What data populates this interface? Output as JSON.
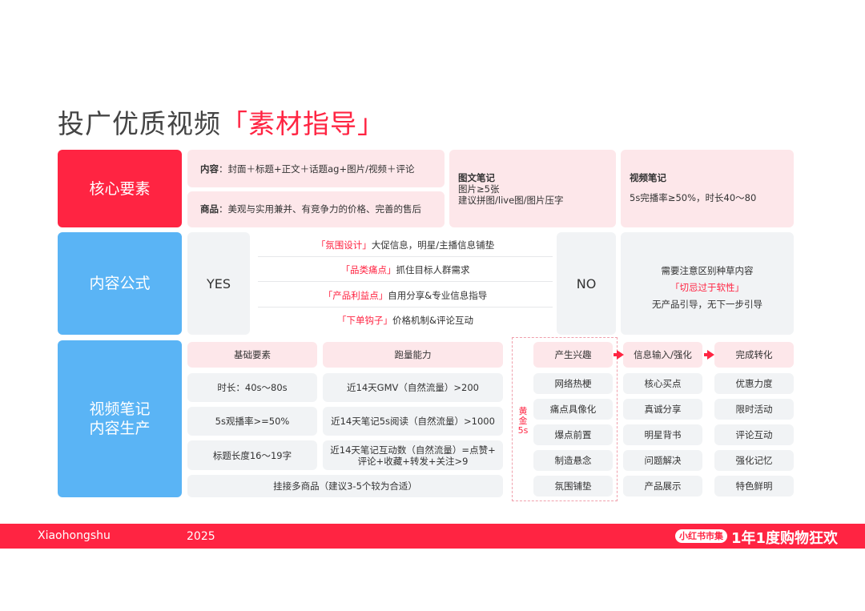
{
  "title": {
    "prefix": "投广优质视频",
    "accent": "「素材指导」"
  },
  "rows": {
    "core": {
      "label": "核心要素",
      "content_key": "内容",
      "content_val": "：封面＋标题+正文＋话题ag+图片/视频＋评论",
      "product_key": "商品",
      "product_val": "：美观与实用兼并、有竞争力的价格、完善的售后",
      "image_note_title": "图文笔记",
      "image_note_line1": "图片≥5张",
      "image_note_line2": "建议拼图/live图/图片压字",
      "video_note_title": "视频笔记",
      "video_note_line1": "5s完播率≥50%，时长40～80"
    },
    "formula": {
      "label": "内容公式",
      "yes": "YES",
      "no": "NO",
      "items": [
        {
          "key": "「氛围设计」",
          "text": "大促信息，明星/主播信息铺垫"
        },
        {
          "key": "「品类痛点」",
          "text": "抓住目标人群需求"
        },
        {
          "key": "「产品利益点」",
          "text": "自用分享&专业信息指导"
        },
        {
          "key": "「下单钩子」",
          "text": "价格机制&评论互动"
        }
      ],
      "no_line1": "需要注意区别种草内容",
      "no_line2": "「切忌过于软性」",
      "no_line3": "无产品引导，无下一步引导"
    },
    "production": {
      "label_line1": "视频笔记",
      "label_line2": "内容生产",
      "basic_header": "基础要素",
      "leap_header": "跑量能力",
      "basic": [
        "时长：40s～80s",
        "5s观播率>=50%",
        "标题长度16～19字"
      ],
      "leap": [
        "近14天GMV（自然流量）>200",
        "近14天笔记5s阅读（自然流量）>1000"
      ],
      "leap_multi_line1": "近14天笔记互动数（自然流量）=点赞+",
      "leap_multi_line2": "评论+收藏+转发+关注>9",
      "bottom": "挂接多商品（建议3-5个较为合适）",
      "golden_line1": "黄",
      "golden_line2": "金",
      "golden_line3": "5s",
      "col_interest": "产生兴趣",
      "col_info": "信息输入/强化",
      "col_convert": "完成转化",
      "interest": [
        "网络热梗",
        "痛点具像化",
        "爆点前置",
        "制造悬念",
        "氛围铺垫"
      ],
      "info": [
        "核心买点",
        "真诚分享",
        "明星背书",
        "问题解决",
        "产品展示"
      ],
      "convert": [
        "优惠力度",
        "限时活动",
        "评论互动",
        "强化记忆",
        "特色鲜明"
      ]
    }
  },
  "footer": {
    "brand": "Xiaohongshu",
    "year": "2025",
    "logo_text": "小红书市集",
    "slogan": "1年1度购物狂欢"
  },
  "colors": {
    "accent": "#ff2442",
    "blue": "#5ab4f5",
    "pink": "#fde7ea",
    "gray": "#f1f3f5"
  }
}
